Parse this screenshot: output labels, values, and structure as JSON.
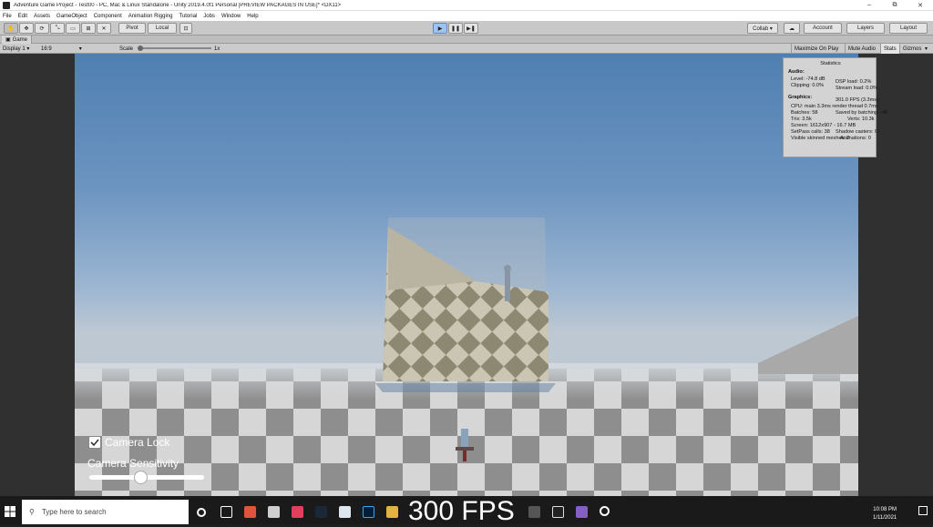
{
  "window": {
    "title": "Adventure Game Project - Test00 - PC, Mac & Linux Standalone - Unity 2019.4.0f1 Personal [PREVIEW PACKAGES IN USE]* <DX11>",
    "minimize": "–",
    "maximize": "⧉",
    "close": "✕"
  },
  "menu": [
    "File",
    "Edit",
    "Assets",
    "GameObject",
    "Component",
    "Animation Rigging",
    "Tutorial",
    "Jobs",
    "Window",
    "Help"
  ],
  "toolbar": {
    "pivot": "Pivot",
    "local": "Local",
    "play": "▶",
    "pause": "❚❚",
    "step": "▶❚",
    "collab": "Collab ▾",
    "account": "Account",
    "layers": "Layers",
    "layout": "Layout"
  },
  "game_tab": {
    "label": "Game",
    "display": "Display 1",
    "aspect": "16:9",
    "scale_label": "Scale",
    "scale_value": "1x",
    "maximize_on_play": "Maximize On Play",
    "mute_audio": "Mute Audio",
    "stats": "Stats",
    "gizmos": "Gizmos"
  },
  "stats": {
    "title": "Statistics",
    "audio_heading": "Audio:",
    "level": "Level: -74.8 dB",
    "clipping": "Clipping: 0.0%",
    "dsp_load": "DSP load: 0.2%",
    "stream_load": "Stream load: 0.0%",
    "graphics_heading": "Graphics:",
    "fps": "301.0 FPS (3.3ms)",
    "cpu": "CPU: main 3.3ms  render thread 0.7ms",
    "batches": "Batches: 58",
    "saved_batching": "Saved by batching: -46",
    "tris": "Tris: 3.5k",
    "verts": "Verts: 10.3k",
    "screen": "Screen: 1612x907 - 16.7 MB",
    "setpass": "SetPass calls: 38",
    "shadow_casters": "Shadow casters: 0",
    "skinned": "Visible skinned meshes: 2",
    "animations": "Animations: 0"
  },
  "overlay": {
    "camera_lock": "Camera Lock",
    "camera_sensitivity": "Camera Sensitivity",
    "sensitivity_value": 0.45,
    "fps_caption": "300 FPS"
  },
  "taskbar": {
    "search_placeholder": "Type here to search",
    "time": "10:08 PM",
    "date": "1/11/2021"
  },
  "colors": {
    "sky_top": "#4f7fb2",
    "unity_toolbar": "#c8c8c8",
    "taskbar": "#1a1a1a"
  }
}
